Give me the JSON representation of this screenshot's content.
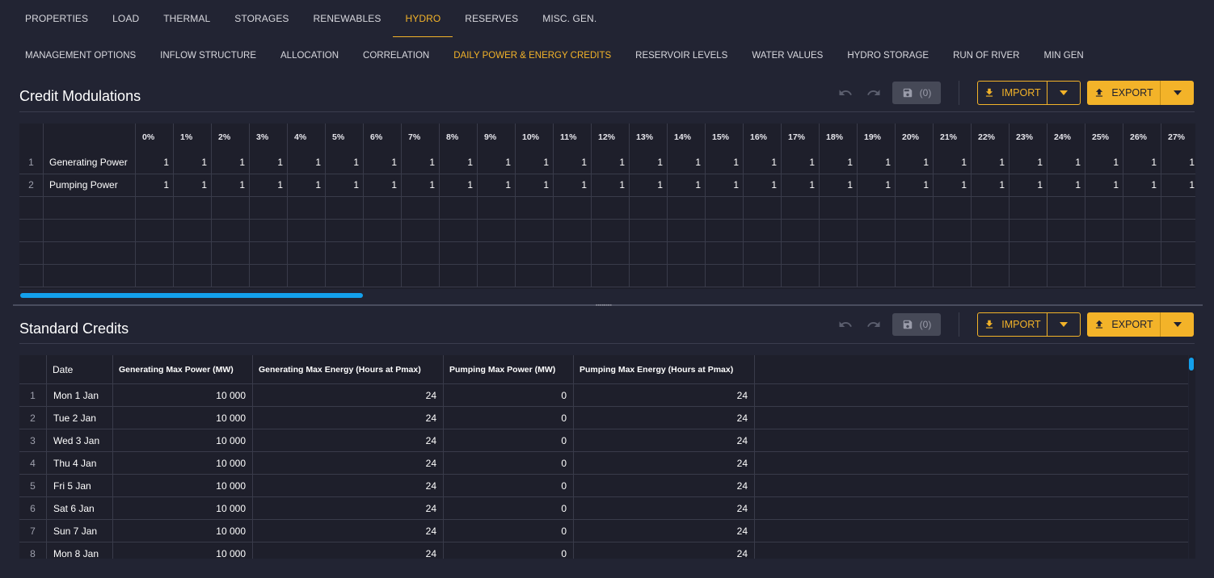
{
  "top_tabs": [
    "PROPERTIES",
    "LOAD",
    "THERMAL",
    "STORAGES",
    "RENEWABLES",
    "HYDRO",
    "RESERVES",
    "MISC. GEN."
  ],
  "top_active": "HYDRO",
  "sub_tabs": [
    "MANAGEMENT OPTIONS",
    "INFLOW STRUCTURE",
    "ALLOCATION",
    "CORRELATION",
    "DAILY POWER & ENERGY CREDITS",
    "RESERVOIR LEVELS",
    "WATER VALUES",
    "HYDRO STORAGE",
    "RUN OF RIVER",
    "MIN GEN"
  ],
  "sub_active": "DAILY POWER & ENERGY CREDITS",
  "credit": {
    "title": "Credit Modulations",
    "save_count": "(0)",
    "import_label": "IMPORT",
    "export_label": "EXPORT",
    "columns": [
      "0%",
      "1%",
      "2%",
      "3%",
      "4%",
      "5%",
      "6%",
      "7%",
      "8%",
      "9%",
      "10%",
      "11%",
      "12%",
      "13%",
      "14%",
      "15%",
      "16%",
      "17%",
      "18%",
      "19%",
      "20%",
      "21%",
      "22%",
      "23%",
      "24%",
      "25%",
      "26%",
      "27%"
    ],
    "rows": [
      {
        "num": "1",
        "label": "Generating Power",
        "values": [
          "1",
          "1",
          "1",
          "1",
          "1",
          "1",
          "1",
          "1",
          "1",
          "1",
          "1",
          "1",
          "1",
          "1",
          "1",
          "1",
          "1",
          "1",
          "1",
          "1",
          "1",
          "1",
          "1",
          "1",
          "1",
          "1",
          "1",
          "1"
        ]
      },
      {
        "num": "2",
        "label": "Pumping Power",
        "values": [
          "1",
          "1",
          "1",
          "1",
          "1",
          "1",
          "1",
          "1",
          "1",
          "1",
          "1",
          "1",
          "1",
          "1",
          "1",
          "1",
          "1",
          "1",
          "1",
          "1",
          "1",
          "1",
          "1",
          "1",
          "1",
          "1",
          "1",
          "1"
        ]
      }
    ]
  },
  "standard": {
    "title": "Standard Credits",
    "save_count": "(0)",
    "import_label": "IMPORT",
    "export_label": "EXPORT",
    "columns": [
      "Date",
      "Generating Max Power (MW)",
      "Generating Max Energy (Hours at Pmax)",
      "Pumping Max Power (MW)",
      "Pumping Max Energy (Hours at Pmax)"
    ],
    "rows": [
      {
        "num": "1",
        "date": "Mon 1 Jan",
        "gen_power": "10 000",
        "gen_energy": "24",
        "pump_power": "0",
        "pump_energy": "24"
      },
      {
        "num": "2",
        "date": "Tue 2 Jan",
        "gen_power": "10 000",
        "gen_energy": "24",
        "pump_power": "0",
        "pump_energy": "24"
      },
      {
        "num": "3",
        "date": "Wed 3 Jan",
        "gen_power": "10 000",
        "gen_energy": "24",
        "pump_power": "0",
        "pump_energy": "24"
      },
      {
        "num": "4",
        "date": "Thu 4 Jan",
        "gen_power": "10 000",
        "gen_energy": "24",
        "pump_power": "0",
        "pump_energy": "24"
      },
      {
        "num": "5",
        "date": "Fri 5 Jan",
        "gen_power": "10 000",
        "gen_energy": "24",
        "pump_power": "0",
        "pump_energy": "24"
      },
      {
        "num": "6",
        "date": "Sat 6 Jan",
        "gen_power": "10 000",
        "gen_energy": "24",
        "pump_power": "0",
        "pump_energy": "24"
      },
      {
        "num": "7",
        "date": "Sun 7 Jan",
        "gen_power": "10 000",
        "gen_energy": "24",
        "pump_power": "0",
        "pump_energy": "24"
      },
      {
        "num": "8",
        "date": "Mon 8 Jan",
        "gen_power": "10 000",
        "gen_energy": "24",
        "pump_power": "0",
        "pump_energy": "24"
      }
    ]
  },
  "colors": {
    "accent": "#f3b329",
    "background": "#222433",
    "grid": "#1e1f2b",
    "scroll": "#13a0ec"
  }
}
